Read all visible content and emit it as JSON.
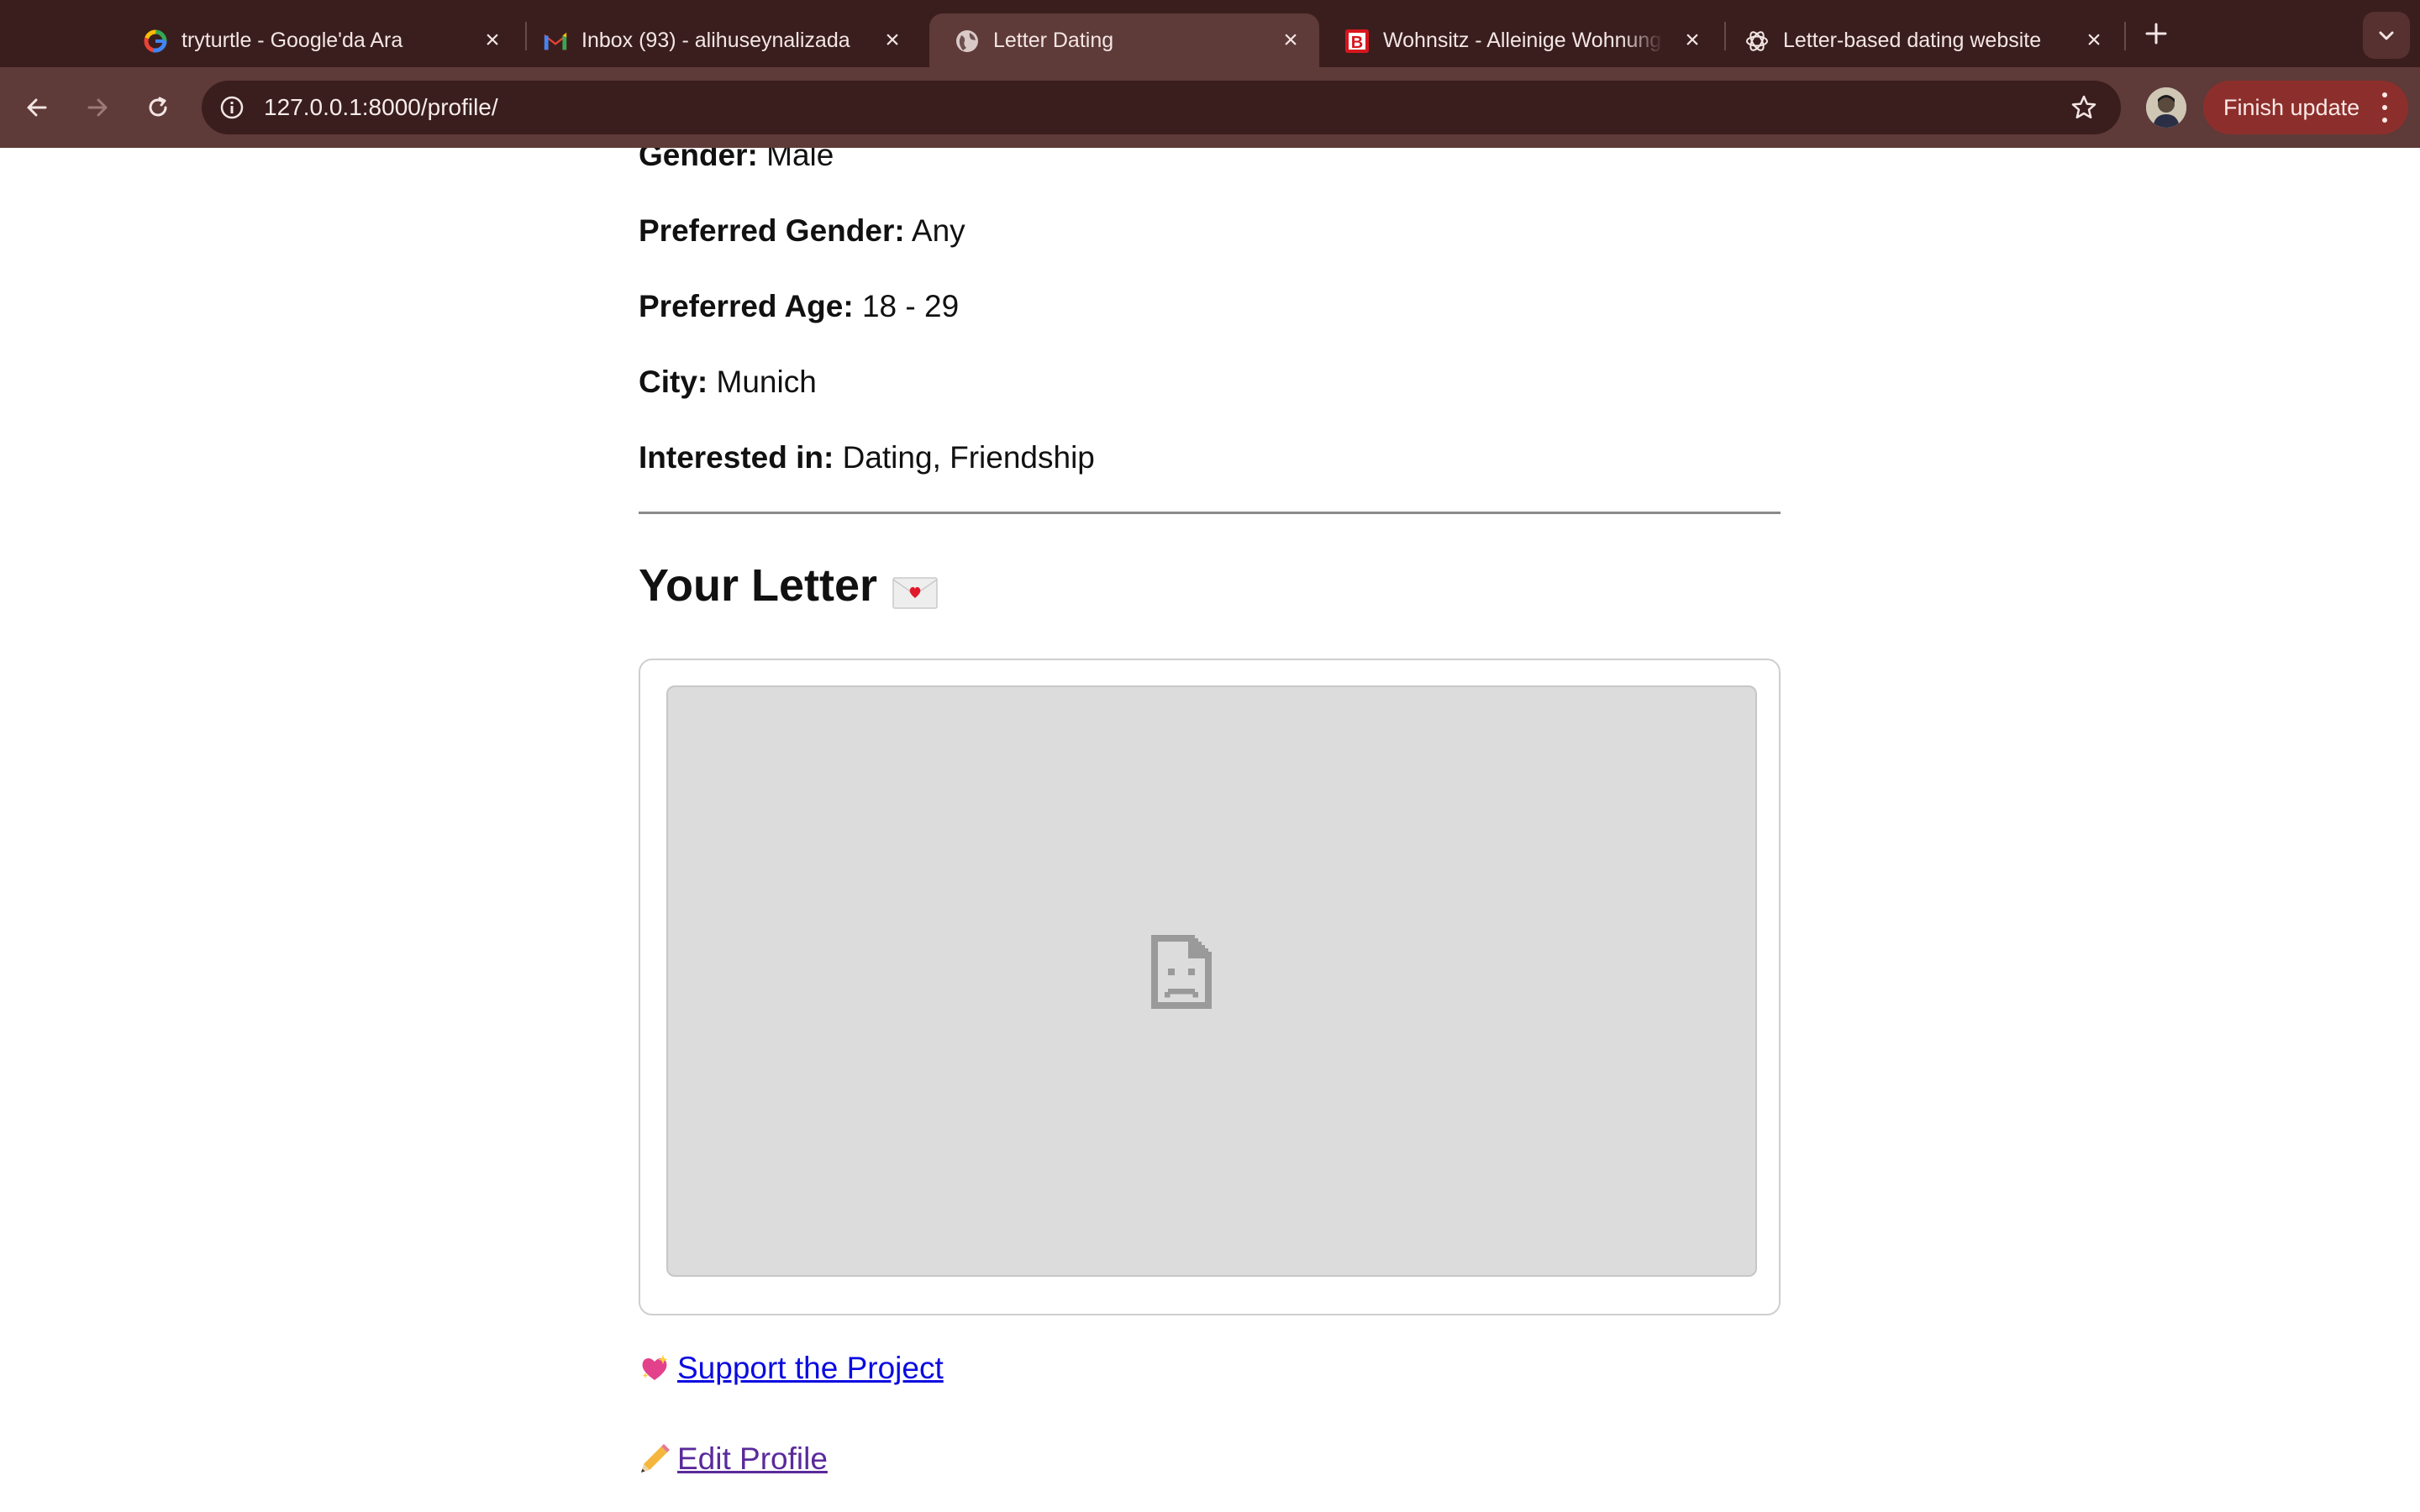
{
  "browser": {
    "tabs": [
      {
        "title": "tryturtle - Google'da Ara",
        "favicon": "google-icon",
        "active": false
      },
      {
        "title": "Inbox (93) - alihuseynalizada",
        "favicon": "gmail-icon",
        "active": false
      },
      {
        "title": "Letter Dating",
        "favicon": "globe-icon",
        "active": true
      },
      {
        "title": "Wohnsitz - Alleinige Wohnung",
        "favicon": "b-brand-icon",
        "active": false
      },
      {
        "title": "Letter-based dating website",
        "favicon": "chatgpt-icon",
        "active": false
      }
    ],
    "url": "127.0.0.1:8000/profile/",
    "finish_update_label": "Finish update",
    "colors": {
      "tabstrip": "#3a1e1e",
      "toolbar": "#5e3a38",
      "update_button": "#8c2f2c"
    }
  },
  "profile": {
    "fields": [
      {
        "label": "Gender:",
        "value": "Male"
      },
      {
        "label": "Preferred Gender:",
        "value": "Any"
      },
      {
        "label": "Preferred Age:",
        "value": "18 - 29"
      },
      {
        "label": "City:",
        "value": "Munich"
      },
      {
        "label": "Interested in:",
        "value": "Dating, Friendship"
      }
    ]
  },
  "letter": {
    "heading": "Your Letter",
    "heading_icon": "love-letter-icon",
    "embed_state": "broken-document-icon"
  },
  "links": {
    "support": {
      "label": "Support the Project",
      "icon": "sparkling-heart-icon",
      "color": "#0b0be0"
    },
    "edit": {
      "label": "Edit Profile",
      "icon": "pencil-icon",
      "color": "#5a2a9a"
    }
  }
}
